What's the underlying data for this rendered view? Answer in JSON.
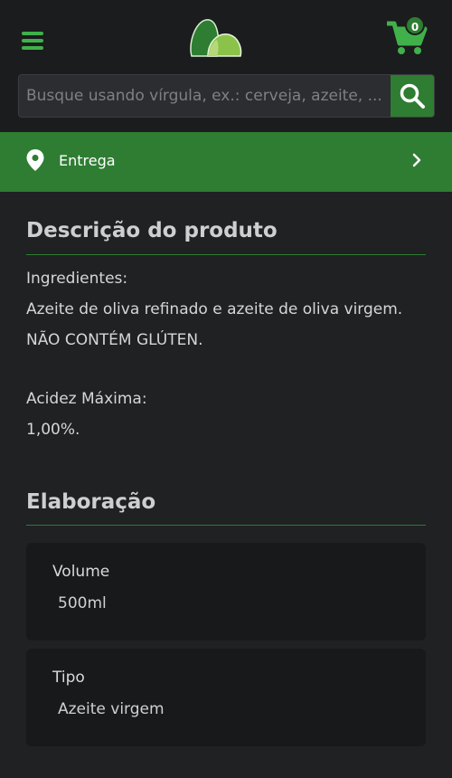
{
  "header": {
    "menu_icon": "hamburger-menu-icon",
    "logo_icon": "leaf-logo-icon",
    "cart_icon": "shopping-cart-icon",
    "cart_count": "0",
    "brand_color": "#2e7d32"
  },
  "search": {
    "placeholder": "Busque usando vírgula, ex.: cerveja, azeite, ...",
    "value": "",
    "button_icon": "search-icon"
  },
  "delivery": {
    "icon": "location-pin-icon",
    "label": "Entrega",
    "chevron": "chevron-right-icon"
  },
  "description": {
    "title": "Descrição do produto",
    "lines": [
      "Ingredientes:",
      "Azeite de oliva refinado e azeite de oliva virgem.",
      "NÃO CONTÉM GLÚTEN.",
      "Acidez Máxima:",
      "1,00%."
    ]
  },
  "elaboration": {
    "title": "Elaboração",
    "specs": [
      {
        "label": "Volume",
        "value": "500ml"
      },
      {
        "label": "Tipo",
        "value": "Azeite virgem"
      }
    ]
  }
}
